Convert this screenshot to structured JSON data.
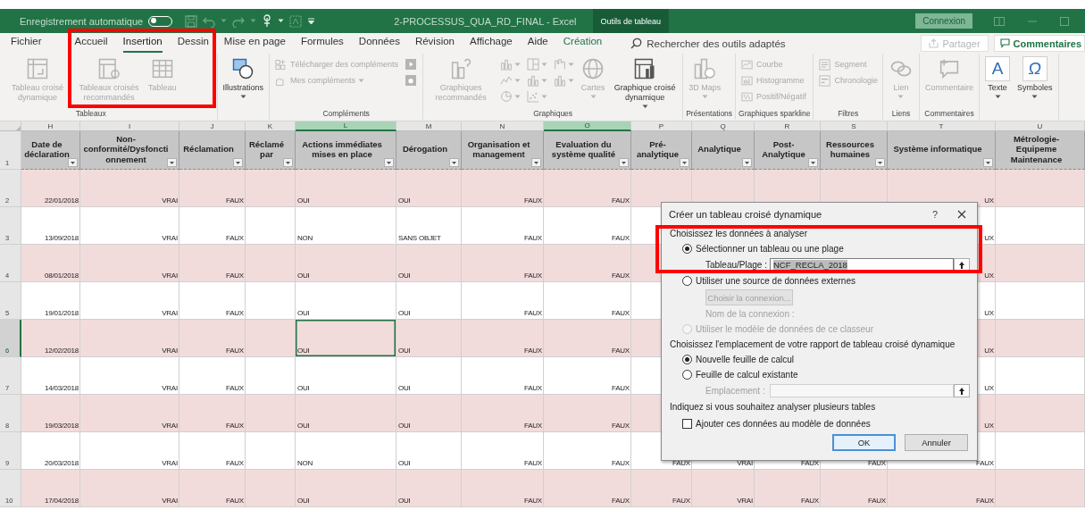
{
  "title_bar": {
    "autosave": {
      "label": "Enregistrement automatique",
      "on": false
    },
    "title": "2-PROCESSUS_QUA_RD_FINAL - Excel",
    "context_tab": "Outils de tableau",
    "signin": "Connexion"
  },
  "tabs": [
    {
      "label": "Fichier",
      "selected": false,
      "kind": "normal"
    },
    {
      "label": "Accueil",
      "selected": false,
      "kind": "normal"
    },
    {
      "label": "Insertion",
      "selected": true,
      "kind": "normal"
    },
    {
      "label": "Dessin",
      "selected": false,
      "kind": "normal"
    },
    {
      "label": "Mise en page",
      "selected": false,
      "kind": "normal"
    },
    {
      "label": "Formules",
      "selected": false,
      "kind": "normal"
    },
    {
      "label": "Données",
      "selected": false,
      "kind": "normal"
    },
    {
      "label": "Révision",
      "selected": false,
      "kind": "normal"
    },
    {
      "label": "Affichage",
      "selected": false,
      "kind": "normal"
    },
    {
      "label": "Aide",
      "selected": false,
      "kind": "normal"
    },
    {
      "label": "Création",
      "selected": false,
      "kind": "contextual"
    }
  ],
  "search": {
    "placeholder": "Rechercher des outils adaptés"
  },
  "share": {
    "label": "Partager",
    "disabled": true
  },
  "comments": {
    "label": "Commentaires"
  },
  "ribbon": {
    "groups": [
      {
        "label": "Tableaux",
        "highlighted": true,
        "items": [
          {
            "kind": "large",
            "label": "Tableau croisé dynamique",
            "disabled": true,
            "menu": false
          },
          {
            "kind": "large",
            "label": "Tableaux croisés recommandés",
            "disabled": true,
            "menu": false
          },
          {
            "kind": "large",
            "label": "Tableau",
            "disabled": true,
            "menu": false
          }
        ]
      },
      {
        "items": [
          {
            "kind": "large",
            "label": "Illustrations",
            "disabled": false,
            "menu": true
          }
        ]
      },
      {
        "label": "Compléments",
        "items": [
          {
            "kind": "stack",
            "items": [
              {
                "kind": "small",
                "label": "Télécharger des compléments",
                "disabled": true,
                "menu": false
              },
              {
                "kind": "small",
                "label": "Mes compléments",
                "disabled": true,
                "menu": true
              }
            ]
          },
          {
            "kind": "stack",
            "items": [
              {
                "kind": "icon",
                "disabled": true,
                "menu": false
              },
              {
                "kind": "icon",
                "disabled": true,
                "menu": false
              }
            ]
          }
        ]
      },
      {
        "label": "Graphiques",
        "items": [
          {
            "kind": "large",
            "label": "Graphiques recommandés",
            "disabled": true,
            "menu": false
          },
          {
            "kind": "stack",
            "items": [
              {
                "kind": "icon",
                "disabled": true,
                "menu": true
              },
              {
                "kind": "icon",
                "disabled": true,
                "menu": true
              },
              {
                "kind": "icon",
                "disabled": true,
                "menu": true
              }
            ]
          },
          {
            "kind": "stack",
            "items": [
              {
                "kind": "icon",
                "disabled": true,
                "menu": true
              },
              {
                "kind": "icon",
                "disabled": true,
                "menu": true
              },
              {
                "kind": "icon",
                "disabled": true,
                "menu": true
              }
            ]
          },
          {
            "kind": "stack",
            "items": [
              {
                "kind": "icon",
                "disabled": true,
                "menu": true
              },
              {
                "kind": "icon",
                "disabled": true,
                "menu": true
              }
            ]
          },
          {
            "kind": "large",
            "label": "Cartes",
            "disabled": true,
            "menu": true
          },
          {
            "kind": "large",
            "label": "Graphique croisé dynamique",
            "disabled": false,
            "menu": true
          }
        ]
      },
      {
        "label": "Présentations",
        "items": [
          {
            "kind": "large",
            "label": "3D Maps",
            "disabled": true,
            "menu": true
          }
        ]
      },
      {
        "label": "Graphiques sparkline",
        "items": [
          {
            "kind": "stack",
            "items": [
              {
                "kind": "small",
                "label": "Courbe",
                "disabled": true,
                "menu": false
              },
              {
                "kind": "small",
                "label": "Histogramme",
                "disabled": true,
                "menu": false
              },
              {
                "kind": "small",
                "label": "Positif/Négatif",
                "disabled": true,
                "menu": false
              }
            ]
          }
        ]
      },
      {
        "label": "Filtres",
        "items": [
          {
            "kind": "stack",
            "items": [
              {
                "kind": "small",
                "label": "Segment",
                "disabled": true,
                "menu": false
              },
              {
                "kind": "small",
                "label": "Chronologie",
                "disabled": true,
                "menu": false
              }
            ]
          }
        ]
      },
      {
        "label": "Liens",
        "items": [
          {
            "kind": "large",
            "label": "Lien",
            "disabled": true,
            "menu": true
          }
        ]
      },
      {
        "label": "Commentaires",
        "items": [
          {
            "kind": "large",
            "label": "Commentaire",
            "disabled": true,
            "menu": false
          }
        ]
      },
      {
        "items": [
          {
            "kind": "large",
            "label": "Texte",
            "glyph": "A",
            "disabled": false,
            "menu": true
          },
          {
            "kind": "large",
            "label": "Symboles",
            "glyph": "Ω",
            "disabled": false,
            "menu": true
          }
        ]
      }
    ]
  },
  "sheet": {
    "columns": [
      {
        "letter": "H",
        "title": "Date de déclaration",
        "kind": "date",
        "selected": false,
        "filter": true
      },
      {
        "letter": "I",
        "title": "Non-conformité/Dysfonctionnement",
        "kind": "boolean",
        "selected": false,
        "filter": true
      },
      {
        "letter": "J",
        "title": "Réclamation",
        "kind": "boolean",
        "selected": false,
        "filter": true
      },
      {
        "letter": "K",
        "title": "Réclamé par",
        "kind": "text",
        "selected": false,
        "filter": true
      },
      {
        "letter": "L",
        "title": "Actions immédiates mises en place",
        "kind": "text",
        "selected": true,
        "filter": true
      },
      {
        "letter": "M",
        "title": "Dérogation",
        "kind": "text",
        "selected": false,
        "filter": true
      },
      {
        "letter": "N",
        "title": "Organisation et management",
        "kind": "boolean",
        "selected": false,
        "filter": true
      },
      {
        "letter": "O",
        "title": "Evaluation du système qualité",
        "kind": "boolean",
        "selected": true,
        "filter": true
      },
      {
        "letter": "P",
        "title": "Pré-analytique",
        "kind": "boolean",
        "selected": false,
        "filter": true
      },
      {
        "letter": "Q",
        "title": "Analytique",
        "kind": "boolean",
        "selected": false,
        "filter": true
      },
      {
        "letter": "R",
        "title": "Post-Analytique",
        "kind": "boolean",
        "selected": false,
        "filter": true
      },
      {
        "letter": "S",
        "title": "Ressources humaines",
        "kind": "boolean",
        "selected": false,
        "filter": true
      },
      {
        "letter": "T",
        "title": "Système informatique",
        "kind": "boolean",
        "selected": false,
        "filter": true
      },
      {
        "letter": "U",
        "title": "Métrologie-Equipeme Maintenance",
        "kind": "boolean",
        "selected": false
      }
    ],
    "header_row": "1",
    "rows": [
      {
        "number": "2",
        "selected": false,
        "cells": [
          {
            "text": "22/01/2018",
            "selected": false
          },
          {
            "text": "VRAI",
            "selected": false
          },
          {
            "text": "FAUX",
            "selected": false
          },
          {
            "selected": false
          },
          {
            "text": "OUI",
            "selected": false
          },
          {
            "text": "OUI",
            "selected": false
          },
          {
            "text": "FAUX",
            "selected": false
          },
          {
            "text": "FAUX",
            "selected": false
          },
          {
            "selected": false
          },
          {
            "selected": false
          },
          {
            "selected": false
          },
          {
            "selected": false
          },
          {
            "text": "UX",
            "selected": false
          },
          {
            "selected": false
          }
        ]
      },
      {
        "number": "3",
        "selected": false,
        "cells": [
          {
            "text": "13/09/2018",
            "selected": false
          },
          {
            "text": "VRAI",
            "selected": false
          },
          {
            "text": "FAUX",
            "selected": false
          },
          {
            "selected": false
          },
          {
            "text": "NON",
            "selected": false
          },
          {
            "text": "SANS OBJET",
            "selected": false
          },
          {
            "text": "FAUX",
            "selected": false
          },
          {
            "text": "FAUX",
            "selected": false
          },
          {
            "selected": false
          },
          null,
          null,
          null,
          {
            "text": "UX",
            "selected": false
          },
          {
            "selected": false
          }
        ]
      },
      {
        "number": "4",
        "selected": false,
        "cells": [
          {
            "text": "08/01/2018",
            "selected": false
          },
          {
            "text": "VRAI",
            "selected": false
          },
          {
            "text": "FAUX",
            "selected": false
          },
          {
            "selected": false
          },
          {
            "text": "OUI",
            "selected": false
          },
          {
            "text": "OUI",
            "selected": false
          },
          {
            "text": "FAUX",
            "selected": false
          },
          {
            "text": "FAUX",
            "selected": false
          },
          {
            "selected": false
          },
          null,
          null,
          null,
          {
            "text": "UX",
            "selected": false
          },
          {
            "selected": false
          }
        ]
      },
      {
        "number": "5",
        "selected": false,
        "cells": [
          {
            "text": "19/01/2018",
            "selected": false
          },
          {
            "text": "VRAI",
            "selected": false
          },
          {
            "text": "FAUX",
            "selected": false
          },
          {
            "selected": false
          },
          {
            "text": "OUI",
            "selected": false
          },
          {
            "text": "OUI",
            "selected": false
          },
          {
            "text": "FAUX",
            "selected": false
          },
          {
            "text": "FAUX",
            "selected": false
          },
          {
            "selected": false
          },
          null,
          null,
          null,
          {
            "text": "UX",
            "selected": false
          },
          {
            "selected": false
          }
        ]
      },
      {
        "number": "6",
        "selected": true,
        "cells": [
          {
            "text": "12/02/2018",
            "selected": false
          },
          {
            "text": "VRAI",
            "selected": false
          },
          {
            "text": "FAUX",
            "selected": false
          },
          {
            "selected": false
          },
          {
            "text": "OUI",
            "selected": true
          },
          {
            "text": "OUI",
            "selected": false
          },
          {
            "text": "FAUX",
            "selected": false
          },
          {
            "text": "FAUX",
            "selected": false
          },
          {
            "selected": false
          },
          null,
          null,
          null,
          {
            "text": "UX",
            "selected": false
          },
          {
            "selected": false
          }
        ]
      },
      {
        "number": "7",
        "selected": false,
        "cells": [
          {
            "text": "14/03/2018",
            "selected": false
          },
          {
            "text": "VRAI",
            "selected": false
          },
          {
            "text": "FAUX",
            "selected": false
          },
          {
            "selected": false
          },
          {
            "text": "OUI",
            "selected": false
          },
          {
            "text": "OUI",
            "selected": false
          },
          {
            "text": "FAUX",
            "selected": false
          },
          {
            "text": "FAUX",
            "selected": false
          },
          {
            "selected": false
          },
          null,
          null,
          null,
          {
            "text": "UX",
            "selected": false
          },
          {
            "selected": false
          }
        ]
      },
      {
        "number": "8",
        "selected": false,
        "cells": [
          {
            "text": "19/03/2018",
            "selected": false
          },
          {
            "text": "VRAI",
            "selected": false
          },
          {
            "text": "FAUX",
            "selected": false
          },
          {
            "selected": false
          },
          {
            "text": "OUI",
            "selected": false
          },
          {
            "text": "OUI",
            "selected": false
          },
          {
            "text": "FAUX",
            "selected": false
          },
          {
            "text": "FAUX",
            "selected": false
          },
          {
            "selected": false
          },
          null,
          null,
          null,
          {
            "text": "UX",
            "selected": false
          },
          {
            "selected": false
          }
        ]
      },
      {
        "number": "9",
        "selected": false,
        "cells": [
          {
            "text": "20/03/2018",
            "selected": false
          },
          {
            "text": "VRAI",
            "selected": false
          },
          {
            "text": "FAUX",
            "selected": false
          },
          {
            "selected": false
          },
          {
            "text": "NON",
            "selected": false
          },
          {
            "text": "OUI",
            "selected": false
          },
          {
            "text": "FAUX",
            "selected": false
          },
          {
            "text": "FAUX",
            "selected": false
          },
          {
            "text": "FAUX",
            "selected": false
          },
          {
            "text": "VRAI",
            "selected": false
          },
          {
            "text": "FAUX",
            "selected": false
          },
          {
            "text": "FAUX",
            "selected": false
          },
          {
            "text": "FAUX",
            "selected": false
          },
          {
            "selected": false
          }
        ]
      },
      {
        "number": "10",
        "selected": false,
        "cells": [
          {
            "text": "17/04/2018",
            "selected": false
          },
          {
            "text": "VRAI",
            "selected": false
          },
          {
            "text": "FAUX",
            "selected": false
          },
          {
            "selected": false
          },
          {
            "text": "OUI",
            "selected": false
          },
          {
            "text": "OUI",
            "selected": false
          },
          {
            "text": "FAUX",
            "selected": false
          },
          {
            "text": "FAUX",
            "selected": false
          },
          {
            "text": "FAUX",
            "selected": false
          },
          {
            "text": "VRAI",
            "selected": false
          },
          {
            "text": "FAUX",
            "selected": false
          },
          {
            "text": "FAUX",
            "selected": false
          },
          {
            "text": "FAUX",
            "selected": false
          },
          {
            "selected": false
          }
        ]
      }
    ]
  },
  "dialog": {
    "title": "Créer un tableau croisé dynamique",
    "help": "?",
    "sections": [
      {
        "heading": "Choisissez les données à analyser",
        "highlighted": true,
        "items": [
          {
            "kind": "radio",
            "label": "Sélectionner un tableau ou une plage",
            "selected": true,
            "disabled": false
          },
          {
            "kind": "field",
            "label": "Tableau/Plage :",
            "value": "NCF_RECLA_2018",
            "disabled": false
          },
          {
            "kind": "radio",
            "label": "Utiliser une source de données externes",
            "selected": false,
            "disabled": false
          },
          {
            "kind": "button",
            "label": "Choisir la connexion...",
            "disabled": true
          },
          {
            "kind": "note",
            "label": "Nom de la connexion :",
            "disabled": true
          },
          {
            "kind": "radio",
            "label": "Utiliser le modèle de données de ce classeur",
            "selected": false,
            "disabled": true
          }
        ]
      },
      {
        "heading": "Choisissez l'emplacement de votre rapport de tableau croisé dynamique",
        "items": [
          {
            "kind": "radio",
            "label": "Nouvelle feuille de calcul",
            "selected": true,
            "disabled": false
          },
          {
            "kind": "radio",
            "label": "Feuille de calcul existante",
            "selected": false,
            "disabled": false
          },
          {
            "kind": "field",
            "label": "Emplacement :",
            "disabled": true
          }
        ]
      },
      {
        "heading": "Indiquez si vous souhaitez analyser plusieurs tables",
        "items": [
          {
            "kind": "checkbox",
            "label": "Ajouter ces données au modèle de données",
            "checked": false
          }
        ]
      }
    ],
    "buttons": [
      {
        "label": "OK",
        "default": true
      },
      {
        "label": "Annuler",
        "default": false
      }
    ]
  }
}
